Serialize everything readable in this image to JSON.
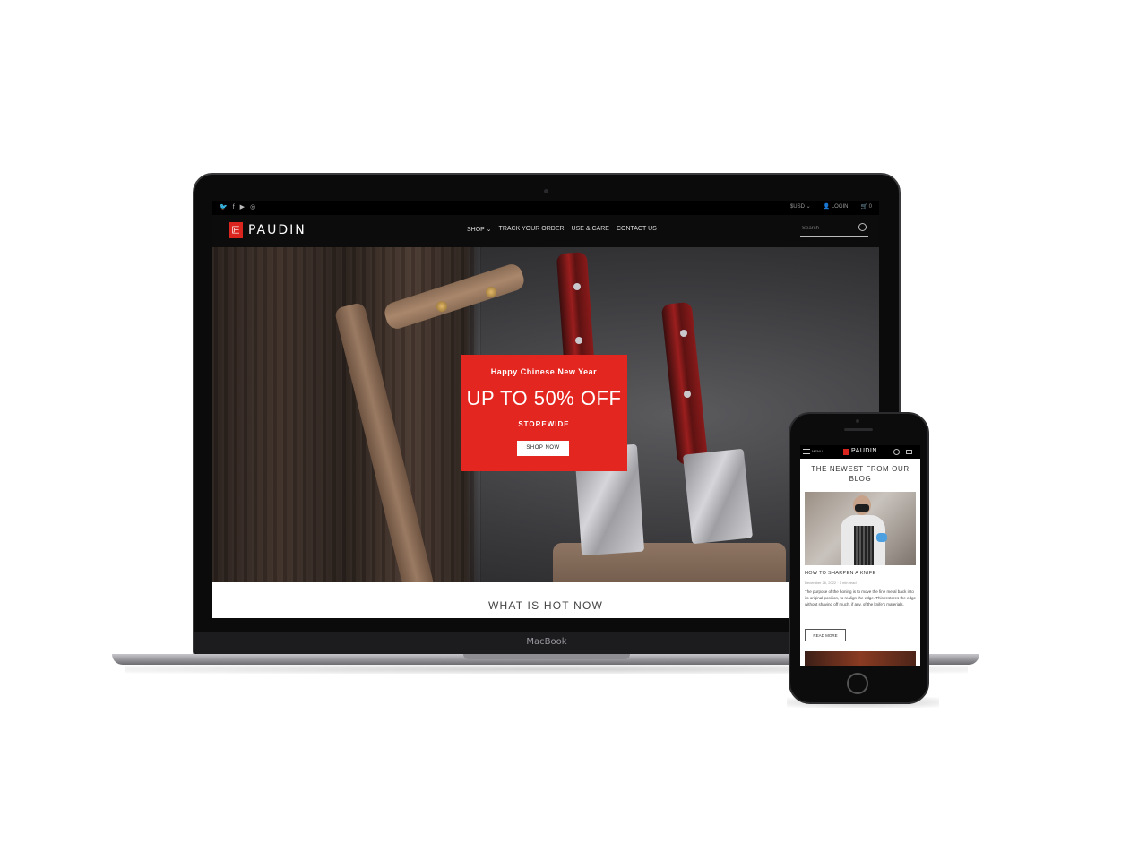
{
  "laptop": {
    "device_label": "MacBook",
    "site": {
      "topbar": {
        "currency": "$USD",
        "login_label": "LOGIN",
        "cart_count": "0"
      },
      "logo": "PAUDIN",
      "nav": [
        "SHOP",
        "TRACK YOUR ORDER",
        "USE & CARE",
        "CONTACT US"
      ],
      "search": {
        "placeholder": "Search"
      },
      "promo": {
        "subtitle": "Happy Chinese New Year",
        "headline": "UP TO 50% OFF",
        "tagline": "STOREWIDE",
        "button": "SHOP NOW"
      },
      "section_title": "WHAT IS HOT NOW"
    }
  },
  "phone": {
    "header": {
      "menu_label": "MENU",
      "logo": "PAUDIN"
    },
    "blog": {
      "title": "THE NEWEST FROM OUR BLOG",
      "post_title": "HOW TO SHARPEN A KNIFE",
      "post_meta": "December 26, 2022 · 1 min read",
      "excerpt": "The purpose of the honing is to move the fine metal back into its original position, to realign the edge. This restores the edge without shaving off much, if any, of the knife's materials.",
      "read_more": "READ MORE"
    }
  },
  "colors": {
    "brand_red": "#e3261f",
    "header_black": "#000000"
  },
  "icons": [
    "twitter-icon",
    "facebook-icon",
    "youtube-icon",
    "instagram-icon",
    "user-icon",
    "cart-icon",
    "search-icon",
    "chevron-down-icon",
    "menu-icon"
  ]
}
